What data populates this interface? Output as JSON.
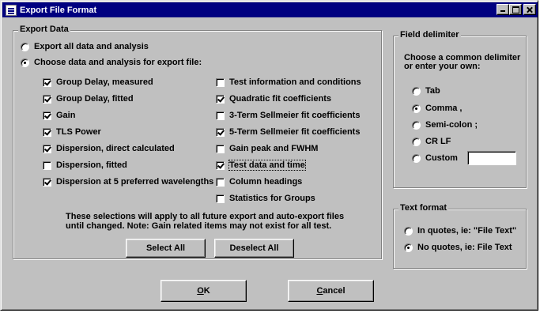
{
  "window": {
    "title": "Export File Format"
  },
  "export_data": {
    "group_title": "Export Data",
    "radio_all": "Export all data and analysis",
    "radio_choose": "Choose data and analysis for export file:",
    "left_items": [
      {
        "label": "Group Delay, measured",
        "checked": true
      },
      {
        "label": "Group Delay, fitted",
        "checked": true
      },
      {
        "label": "Gain",
        "checked": true
      },
      {
        "label": "TLS Power",
        "checked": true
      },
      {
        "label": "Dispersion, direct calculated",
        "checked": true
      },
      {
        "label": "Dispersion, fitted",
        "checked": false
      },
      {
        "label": "Dispersion at 5 preferred wavelengths",
        "checked": true
      }
    ],
    "right_items": [
      {
        "label": "Test information and conditions",
        "checked": false
      },
      {
        "label": "Quadratic fit coefficients",
        "checked": true
      },
      {
        "label": "3-Term Sellmeier fit coefficients",
        "checked": false
      },
      {
        "label": "5-Term Sellmeier fit coefficients",
        "checked": true
      },
      {
        "label": "Gain peak and FWHM",
        "checked": false
      },
      {
        "label": "Test data and time",
        "checked": true
      },
      {
        "label": "Column headings",
        "checked": false
      },
      {
        "label": "Statistics for Groups",
        "checked": false
      }
    ],
    "note_line1": "These selections will apply to all future export and auto-export files",
    "note_line2": "until changed.  Note:  Gain related items may not exist for all test.",
    "select_all": "Select All",
    "deselect_all": "Deselect All"
  },
  "field_delimiter": {
    "group_title": "Field delimiter",
    "note_line1": "Choose a common delimiter",
    "note_line2": "or enter your own:",
    "options": [
      {
        "label": "Tab",
        "selected": false
      },
      {
        "label": "Comma ,",
        "selected": true
      },
      {
        "label": "Semi-colon ;",
        "selected": false
      },
      {
        "label": "CR LF",
        "selected": false
      },
      {
        "label": "Custom",
        "selected": false
      }
    ],
    "custom_value": ""
  },
  "text_format": {
    "group_title": "Text format",
    "options": [
      {
        "label": "In quotes, ie: \"File Text\"",
        "selected": false
      },
      {
        "label": "No quotes, ie: File Text",
        "selected": true
      }
    ]
  },
  "buttons": {
    "ok_underlined": "O",
    "ok_rest": "K",
    "cancel_underlined": "C",
    "cancel_rest": "ancel"
  }
}
